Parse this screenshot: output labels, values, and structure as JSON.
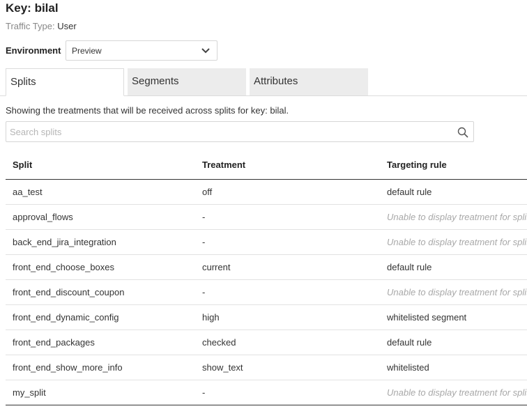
{
  "header": {
    "title": "Key: bilal",
    "traffic_label": "Traffic Type:",
    "traffic_value": "User"
  },
  "environment": {
    "label": "Environment",
    "selected": "Preview"
  },
  "tabs": [
    {
      "label": "Splits",
      "active": true
    },
    {
      "label": "Segments",
      "active": false
    },
    {
      "label": "Attributes",
      "active": false
    }
  ],
  "description": "Showing the treatments that will be received across splits for key: bilal.",
  "search": {
    "placeholder": "Search splits",
    "value": ""
  },
  "table": {
    "columns": [
      "Split",
      "Treatment",
      "Targeting rule"
    ],
    "rows": [
      {
        "split": "aa_test",
        "treatment": "off",
        "rule": "default rule",
        "muted": false
      },
      {
        "split": "approval_flows",
        "treatment": "-",
        "rule": "Unable to display treatment for split",
        "muted": true
      },
      {
        "split": "back_end_jira_integration",
        "treatment": "-",
        "rule": "Unable to display treatment for split",
        "muted": true
      },
      {
        "split": "front_end_choose_boxes",
        "treatment": "current",
        "rule": "default rule",
        "muted": false
      },
      {
        "split": "front_end_discount_coupon",
        "treatment": "-",
        "rule": "Unable to display treatment for split",
        "muted": true
      },
      {
        "split": "front_end_dynamic_config",
        "treatment": "high",
        "rule": "whitelisted segment",
        "muted": false
      },
      {
        "split": "front_end_packages",
        "treatment": "checked",
        "rule": "default rule",
        "muted": false
      },
      {
        "split": "front_end_show_more_info",
        "treatment": "show_text",
        "rule": "whitelisted",
        "muted": false
      },
      {
        "split": "my_split",
        "treatment": "-",
        "rule": "Unable to display treatment for split",
        "muted": true
      }
    ]
  }
}
